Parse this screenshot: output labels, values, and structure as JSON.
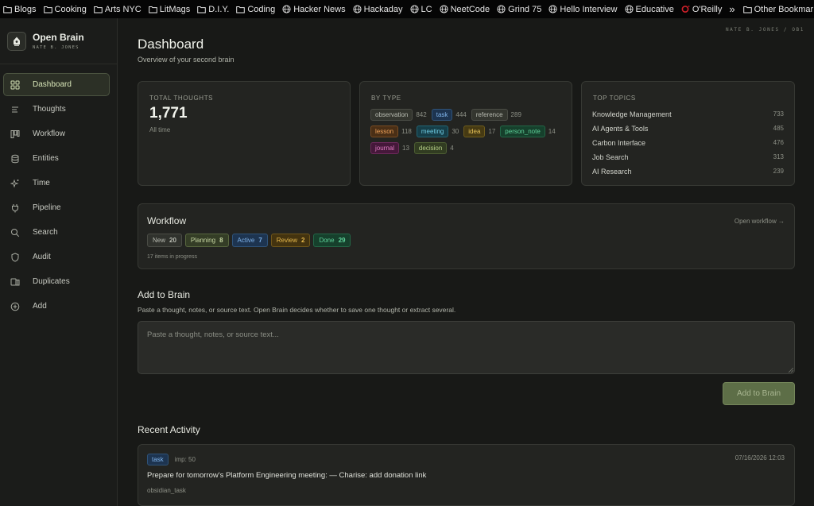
{
  "bookmarks": {
    "items": [
      {
        "label": "Blogs",
        "icon": "folder-icon"
      },
      {
        "label": "Cooking",
        "icon": "folder-icon"
      },
      {
        "label": "Arts NYC",
        "icon": "folder-icon"
      },
      {
        "label": "LitMags",
        "icon": "folder-icon"
      },
      {
        "label": "D.I.Y.",
        "icon": "folder-icon"
      },
      {
        "label": "Coding",
        "icon": "folder-icon"
      },
      {
        "label": "Hacker News",
        "icon": "globe-icon"
      },
      {
        "label": "Hackaday",
        "icon": "globe-icon"
      },
      {
        "label": "LC",
        "icon": "globe-icon"
      },
      {
        "label": "NeetCode",
        "icon": "globe-icon"
      },
      {
        "label": "Grind 75",
        "icon": "globe-icon"
      },
      {
        "label": "Hello Interview",
        "icon": "globe-icon"
      },
      {
        "label": "Educative",
        "icon": "globe-icon"
      },
      {
        "label": "O'Reilly",
        "icon": "oreilly-icon"
      }
    ],
    "overflow": "»",
    "other_label": "Other Bookmarks"
  },
  "brand": {
    "title": "Open Brain",
    "subtitle": "NATE B. JONES"
  },
  "sidebar": {
    "items": [
      {
        "label": "Dashboard",
        "icon": "grid-icon",
        "active": true
      },
      {
        "label": "Thoughts",
        "icon": "list-icon"
      },
      {
        "label": "Workflow",
        "icon": "kanban-icon"
      },
      {
        "label": "Entities",
        "icon": "database-icon"
      },
      {
        "label": "Time",
        "icon": "sparkles-icon"
      },
      {
        "label": "Pipeline",
        "icon": "plug-icon"
      },
      {
        "label": "Search",
        "icon": "search-icon"
      },
      {
        "label": "Audit",
        "icon": "shield-icon"
      },
      {
        "label": "Duplicates",
        "icon": "duplicates-icon"
      },
      {
        "label": "Add",
        "icon": "plus-circle-icon"
      }
    ]
  },
  "header": {
    "user_tag": "NATE B. JONES / OB1",
    "title": "Dashboard",
    "subtitle": "Overview of your second brain"
  },
  "stats": {
    "total": {
      "label": "TOTAL THOUGHTS",
      "value": "1,771",
      "note": "All time"
    },
    "by_type": {
      "label": "BY TYPE",
      "rows": [
        [
          {
            "name": "observation",
            "count": "842",
            "color": "#b9bcb2",
            "bg": "#34362f",
            "border": "#4a4c45"
          },
          {
            "name": "task",
            "count": "444",
            "color": "#7fb3ea",
            "bg": "#1d3450",
            "border": "#2f5378"
          },
          {
            "name": "reference",
            "count": "289",
            "color": "#b9bcb2",
            "bg": "#34362f",
            "border": "#4a4c45"
          }
        ],
        [
          {
            "name": "lesson",
            "count": "118",
            "color": "#f0a35a",
            "bg": "#4a2f16",
            "border": "#7a4c22"
          },
          {
            "name": "meeting",
            "count": "30",
            "color": "#6fcde4",
            "bg": "#163e48",
            "border": "#236574"
          },
          {
            "name": "idea",
            "count": "17",
            "color": "#e6c257",
            "bg": "#463a13",
            "border": "#6f5c1c"
          },
          {
            "name": "person_note",
            "count": "14",
            "color": "#5fd39b",
            "bg": "#16402c",
            "border": "#236646"
          }
        ],
        [
          {
            "name": "journal",
            "count": "13",
            "color": "#e47fc6",
            "bg": "#45183a",
            "border": "#6d2a5c"
          },
          {
            "name": "decision",
            "count": "4",
            "color": "#b9d38a",
            "bg": "#313c21",
            "border": "#4d5e33"
          }
        ]
      ]
    },
    "top_topics": {
      "label": "TOP TOPICS",
      "items": [
        {
          "name": "Knowledge Management",
          "count": "733"
        },
        {
          "name": "AI Agents & Tools",
          "count": "485"
        },
        {
          "name": "Carbon Interface",
          "count": "476"
        },
        {
          "name": "Job Search",
          "count": "313"
        },
        {
          "name": "AI Research",
          "count": "239"
        }
      ]
    }
  },
  "workflow": {
    "title": "Workflow",
    "link": "Open workflow →",
    "pills": [
      {
        "label": "New",
        "count": "20",
        "color": "#b9bcb2",
        "bg": "#30322d",
        "border": "#4a4c45"
      },
      {
        "label": "Planning",
        "count": "8",
        "color": "#c8d8a3",
        "bg": "#343d26",
        "border": "#58663f"
      },
      {
        "label": "Active",
        "count": "7",
        "color": "#7fb3ea",
        "bg": "#1d3450",
        "border": "#2f5378"
      },
      {
        "label": "Review",
        "count": "2",
        "color": "#e6b94c",
        "bg": "#43330f",
        "border": "#6f561a"
      },
      {
        "label": "Done",
        "count": "29",
        "color": "#5fd39b",
        "bg": "#16402c",
        "border": "#236646"
      }
    ],
    "note": "17 items in progress"
  },
  "add": {
    "title": "Add to Brain",
    "subtitle": "Paste a thought, notes, or source text. Open Brain decides whether to save one thought or extract several.",
    "placeholder": "Paste a thought, notes, or source text...",
    "button": "Add to Brain"
  },
  "recent": {
    "title": "Recent Activity",
    "items": [
      {
        "type": "task",
        "importance": "imp: 50",
        "date": "07/16/2026 12:03",
        "text": "Prepare for tomorrow's Platform Engineering meeting: — Charise: add donation link",
        "source": "obsidian_task"
      }
    ]
  }
}
